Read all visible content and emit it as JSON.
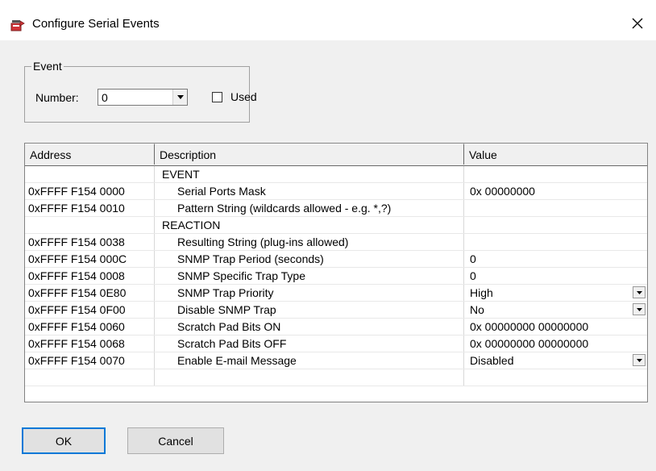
{
  "window": {
    "title": "Configure Serial Events",
    "icon": "serial-port-icon"
  },
  "event_group": {
    "legend": "Event",
    "number_label": "Number:",
    "number_value": "0",
    "used_label": "Used",
    "used_checked": false
  },
  "grid": {
    "headers": {
      "address": "Address",
      "description": "Description",
      "value": "Value"
    },
    "rows": [
      {
        "address": "",
        "description": "EVENT",
        "value": "",
        "indent": false
      },
      {
        "address": "0xFFFF F154 0000",
        "description": "Serial Ports Mask",
        "value": "0x 00000000",
        "indent": true
      },
      {
        "address": "0xFFFF F154 0010",
        "description": "Pattern String (wildcards allowed - e.g. *,?)",
        "value": "",
        "indent": true
      },
      {
        "address": "",
        "description": "REACTION",
        "value": "",
        "indent": false
      },
      {
        "address": "0xFFFF F154 0038",
        "description": "Resulting String (plug-ins allowed)",
        "value": "",
        "indent": true
      },
      {
        "address": "0xFFFF F154 000C",
        "description": "SNMP Trap Period (seconds)",
        "value": "0",
        "indent": true
      },
      {
        "address": "0xFFFF F154 0008",
        "description": "SNMP Specific Trap Type",
        "value": "0",
        "indent": true
      },
      {
        "address": "0xFFFF F154 0E80",
        "description": "SNMP Trap Priority",
        "value": "High",
        "indent": true,
        "dropdown": true
      },
      {
        "address": "0xFFFF F154 0F00",
        "description": "Disable SNMP Trap",
        "value": "No",
        "indent": true,
        "dropdown": true
      },
      {
        "address": "0xFFFF F154 0060",
        "description": "Scratch Pad Bits ON",
        "value": "0x 00000000  00000000",
        "indent": true
      },
      {
        "address": "0xFFFF F154 0068",
        "description": "Scratch Pad Bits OFF",
        "value": "0x 00000000  00000000",
        "indent": true
      },
      {
        "address": "0xFFFF F154 0070",
        "description": "Enable E-mail Message",
        "value": "Disabled",
        "indent": true,
        "dropdown": true
      },
      {
        "address": "",
        "description": "",
        "value": "",
        "indent": false
      }
    ]
  },
  "buttons": {
    "ok": "OK",
    "cancel": "Cancel"
  }
}
